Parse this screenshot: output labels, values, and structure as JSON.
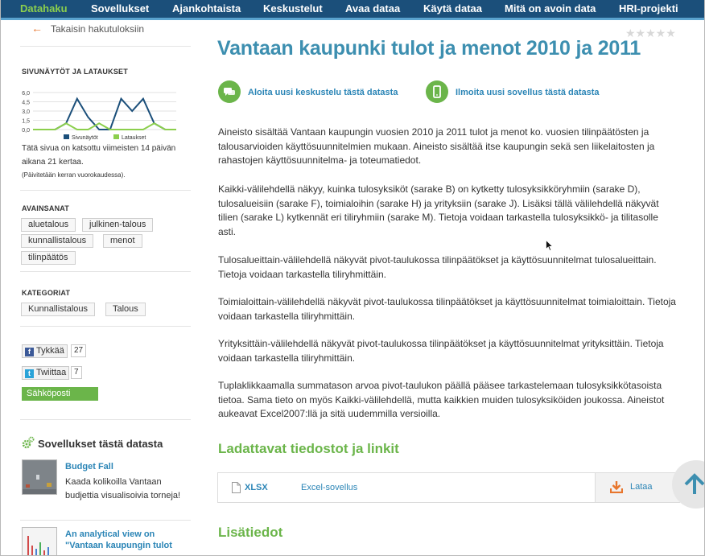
{
  "nav": {
    "items": [
      "Datahaku",
      "Sovellukset",
      "Ajankohtaista",
      "Keskustelut",
      "Avaa dataa",
      "Käytä dataa",
      "Mitä on avoin data",
      "HRI-projekti"
    ],
    "active": "Datahaku"
  },
  "back_link": "Takaisin hakutuloksiin",
  "rating": "★★★★★",
  "sidebar": {
    "pageviews_heading": "SIVUNÄYTÖT JA LATAUKSET",
    "chart_data": {
      "type": "line",
      "y_ticks": [
        "6,0",
        "4,5",
        "3,0",
        "1,5",
        "0,0"
      ],
      "ylim": [
        0,
        6
      ],
      "series": [
        {
          "name": "Sivunäytöt",
          "color": "#1b4f7a",
          "values": [
            0,
            0,
            0,
            1,
            5,
            2,
            0,
            0,
            5,
            3,
            5,
            1,
            0,
            0
          ]
        },
        {
          "name": "Lataukset",
          "color": "#8ccf4d",
          "values": [
            0,
            0,
            0,
            1,
            0,
            0,
            1,
            0,
            0,
            0,
            0,
            1,
            0,
            0
          ]
        }
      ]
    },
    "views_text_1": "Tätä sivua on katsottu viimeisten 14 päivän",
    "views_text_2": "aikana 21 kertaa.",
    "views_note": "(Päivitetään kerran vuorokaudessa).",
    "keywords_heading": "AVAINSANAT",
    "keywords": [
      "aluetalous",
      "julkinen-talous",
      "kunnallistalous",
      "menot",
      "tilinpäätös"
    ],
    "categories_heading": "KATEGORIAT",
    "categories": [
      "Kunnallistalous",
      "Talous"
    ],
    "facebook_label": "Tykkää",
    "facebook_count": "27",
    "twitter_label": "Twiittaa",
    "twitter_count": "7",
    "email_label": "Sähköposti",
    "apps_heading": "Sovellukset tästä datasta",
    "apps": [
      {
        "title": "Budget Fall",
        "desc": "Kaada kolikoilla Vantaan budjettia visualisoivia torneja!"
      },
      {
        "title": "An analytical view on \"Vantaan kaupungin tulot",
        "desc": ""
      }
    ]
  },
  "main": {
    "title": "Vantaan kaupunki tulot ja menot 2010 ja 2011",
    "actions": {
      "discussion": "Aloita uusi keskustelu tästä datasta",
      "app": "Ilmoita uusi sovellus tästä datasta"
    },
    "paragraphs": [
      "Aineisto sisältää Vantaan kaupungin vuosien 2010 ja 2011 tulot ja menot ko. vuosien tilinpäätösten ja talousarvioiden käyttösuunnitelmien mukaan. Aineisto sisältää itse kaupungin sekä sen liikelaitosten ja rahastojen käyttösuunnitelma- ja toteumatiedot.",
      "Kaikki-välilehdellä näkyy, kuinka tulosyksiköt (sarake B) on kytketty tulosyksikköryhmiin (sarake D), tulosalueisiin (sarake F), toimialoihin (sarake H) ja yrityksiin (sarake J). Lisäksi tällä välilehdellä näkyvät tilien (sarake L) kytkennät eri tiliryhmiin (sarake M). Tietoja voidaan tarkastella tulosyksikkö- ja tilitasolle asti.",
      "Tulosalueittain-välilehdellä näkyvät pivot-taulukossa tilinpäätökset ja käyttösuunnitelmat tulosalueittain. Tietoja voidaan tarkastella tiliryhmittäin.",
      "Toimialoittain-välilehdellä näkyvät pivot-taulukossa tilinpäätökset ja käyttösuunnitelmat toimialoittain. Tietoja voidaan tarkastella tiliryhmittäin.",
      "Yrityksittäin-välilehdellä näkyvät pivot-taulukossa tilinpäätökset ja käyttösuunnitelmat yrityksittäin. Tietoja voidaan tarkastella tiliryhmittäin.",
      "Tuplaklikkaamalla summatason arvoa pivot-taulukon päällä pääsee tarkastelemaan tulosyksikkötasoista tietoa. Sama tieto on myös Kaikki-välilehdellä, mutta kaikkien muiden tulosyksiköiden joukossa. Aineistot aukeavat Excel2007:llä ja sitä uudemmilla versioilla."
    ],
    "downloads_heading": "Ladattavat tiedostot ja linkit",
    "file": {
      "format": "XLSX",
      "name": "Excel-sovellus",
      "download_label": "Lataa"
    },
    "more_heading": "Lisätiedot"
  },
  "colors": {
    "nav_bg": "#1b4f7a",
    "title": "#3d8fb0",
    "accent_green": "#6bb54a",
    "link": "#2b85b6"
  }
}
